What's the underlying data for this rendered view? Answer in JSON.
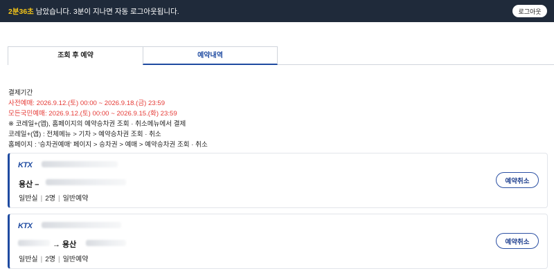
{
  "topbar": {
    "time_left": "2분36초",
    "message": " 남았습니다. 3분이 지나면 자동 로그아웃됩니다.",
    "logout_label": "로그아웃"
  },
  "tabs": [
    {
      "label": "조회 후 예약",
      "active": false
    },
    {
      "label": "예약내역",
      "active": true
    }
  ],
  "notice": {
    "heading": "결제기간",
    "line1": "사전예매: 2026.9.12.(토) 00:00 ~ 2026.9.18.(금) 23:59",
    "line2": "모든국민예매: 2026.9.12.(토) 00:00 ~ 2026.9.15.(화) 23:59",
    "line3": "※ 코레일+(앱), 홈페이지의 예약승차권 조회 · 취소메뉴에서 결제",
    "line4": "코레일+(앱) : 전체메뉴 > 기차 > 예약승차권 조회 · 취소",
    "line5": "홈페이지 : '승차권예매' 페이지 > 승차권 > 예매 > 예약승차권 조회 · 취소"
  },
  "reservations": [
    {
      "train_logo": "KTX",
      "route_text": "용산 –",
      "seat_class": "일반실",
      "count": "2명",
      "type": "일반예약",
      "cancel_label": "예약취소"
    },
    {
      "train_logo": "KTX",
      "route_text": "→ 용산",
      "seat_class": "일반실",
      "count": "2명",
      "type": "일반예약",
      "cancel_label": "예약취소"
    }
  ],
  "colors": {
    "topbar_bg": "#1f2a3a",
    "accent": "#1e4aa0",
    "warning": "#e53935",
    "time_highlight": "#f5c518"
  }
}
